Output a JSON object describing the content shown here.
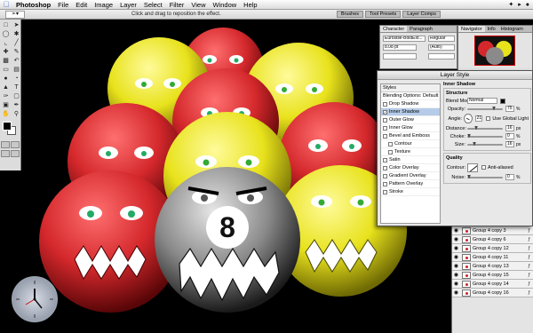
{
  "menubar": {
    "app": "Photoshop",
    "items": [
      "File",
      "Edit",
      "Image",
      "Layer",
      "Select",
      "Filter",
      "View",
      "Window",
      "Help"
    ]
  },
  "options_bar": {
    "hint": "Click and drag to reposition the effect.",
    "well_tabs": [
      "Brushes",
      "Tool Presets",
      "Layer Comps"
    ]
  },
  "toolbox": {
    "tools": [
      "marquee-icon",
      "move-icon",
      "lasso-icon",
      "magic-wand-icon",
      "crop-icon",
      "slice-icon",
      "healing-icon",
      "brush-icon",
      "stamp-icon",
      "history-brush-icon",
      "eraser-icon",
      "gradient-icon",
      "blur-icon",
      "dodge-icon",
      "path-select-icon",
      "type-icon",
      "pen-icon",
      "shape-icon",
      "notes-icon",
      "eyedropper-icon",
      "hand-icon",
      "zoom-icon"
    ]
  },
  "character_palette": {
    "tabs": [
      "Character",
      "Paragraph"
    ],
    "font": "Eurostile-BoldExt...",
    "style": "Regular",
    "size": "8.08 pt",
    "leading": "(Auto)"
  },
  "navigator_palette": {
    "tabs": [
      "Navigator",
      "Info",
      "Histogram"
    ]
  },
  "layer_style": {
    "title": "Layer Style",
    "styles_header": "Styles",
    "blending_options": "Blending Options: Default",
    "styles": [
      {
        "label": "Drop Shadow",
        "checked": false,
        "selected": false,
        "indent": false
      },
      {
        "label": "Inner Shadow",
        "checked": true,
        "selected": true,
        "indent": false
      },
      {
        "label": "Outer Glow",
        "checked": false,
        "selected": false,
        "indent": false
      },
      {
        "label": "Inner Glow",
        "checked": false,
        "selected": false,
        "indent": false
      },
      {
        "label": "Bevel and Emboss",
        "checked": false,
        "selected": false,
        "indent": false
      },
      {
        "label": "Contour",
        "checked": false,
        "selected": false,
        "indent": true
      },
      {
        "label": "Texture",
        "checked": false,
        "selected": false,
        "indent": true
      },
      {
        "label": "Satin",
        "checked": false,
        "selected": false,
        "indent": false
      },
      {
        "label": "Color Overlay",
        "checked": false,
        "selected": false,
        "indent": false
      },
      {
        "label": "Gradient Overlay",
        "checked": false,
        "selected": false,
        "indent": false
      },
      {
        "label": "Pattern Overlay",
        "checked": false,
        "selected": false,
        "indent": false
      },
      {
        "label": "Stroke",
        "checked": false,
        "selected": false,
        "indent": false
      }
    ],
    "section_title": "Inner Shadow",
    "structure": {
      "label": "Structure",
      "blend_mode_label": "Blend Mode:",
      "blend_mode": "Normal",
      "opacity_label": "Opacity:",
      "opacity": "75",
      "angle_label": "Angle:",
      "angle": "21",
      "use_global_light": "Use Global Light",
      "distance_label": "Distance:",
      "distance": "16",
      "choke_label": "Choke:",
      "choke": "0",
      "size_label": "Size:",
      "size": "16",
      "unit_percent": "%",
      "unit_px": "px"
    },
    "quality": {
      "label": "Quality",
      "contour_label": "Contour:",
      "anti_aliased": "Anti-aliased",
      "noise_label": "Noise:",
      "noise": "0"
    },
    "colors": {
      "shadow": "#000000",
      "selected_row": "#b5cbe8"
    }
  },
  "layers": [
    {
      "name": "Group 4 copy 3",
      "fx": true
    },
    {
      "name": "Group 4 copy 6",
      "fx": true
    },
    {
      "name": "Group 4 copy 12",
      "fx": true
    },
    {
      "name": "Group 4 copy 11",
      "fx": true
    },
    {
      "name": "Group 4 copy 13",
      "fx": true
    },
    {
      "name": "Group 4 copy 15",
      "fx": true
    },
    {
      "name": "Group 4 copy 14",
      "fx": true
    },
    {
      "name": "Group 4 copy 16",
      "fx": true
    }
  ],
  "artwork": {
    "ball_number": "8",
    "colors": {
      "red": "#d4282c",
      "yellow": "#e8e21c",
      "gray": "#8a8a8a"
    }
  }
}
